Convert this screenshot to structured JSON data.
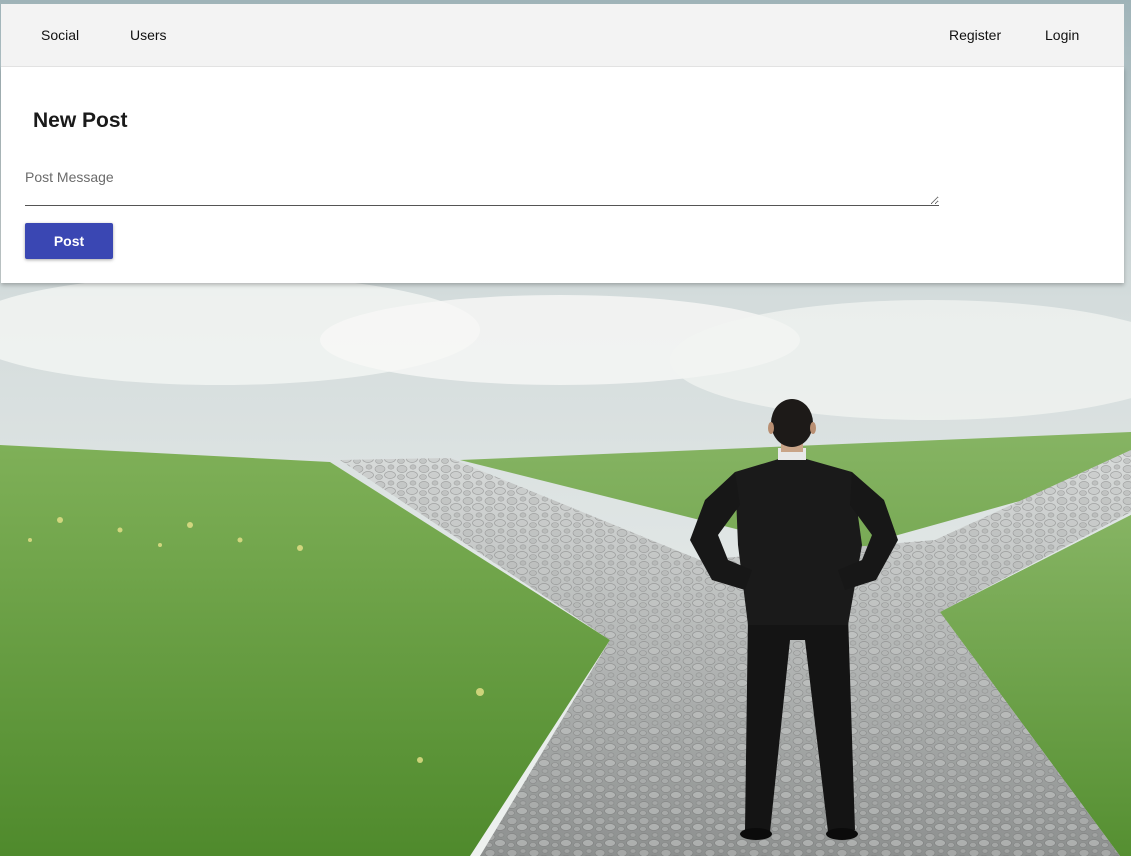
{
  "navbar": {
    "left_links": [
      {
        "label": "Social"
      },
      {
        "label": "Users"
      }
    ],
    "right_links": [
      {
        "label": "Register"
      },
      {
        "label": "Login"
      }
    ]
  },
  "post_form": {
    "title": "New Post",
    "message": {
      "placeholder": "Post Message",
      "value": ""
    },
    "submit_label": "Post"
  },
  "background": {
    "description_icon": "crossroads-photo",
    "colors": {
      "sky": "#dfe5e6",
      "grass": "#6aa23f",
      "path": "#a9abab",
      "suit": "#151515"
    }
  },
  "theme": {
    "accent": "#3a47b3",
    "navbar_bg": "#f3f3f3",
    "card_bg": "#ffffff"
  }
}
